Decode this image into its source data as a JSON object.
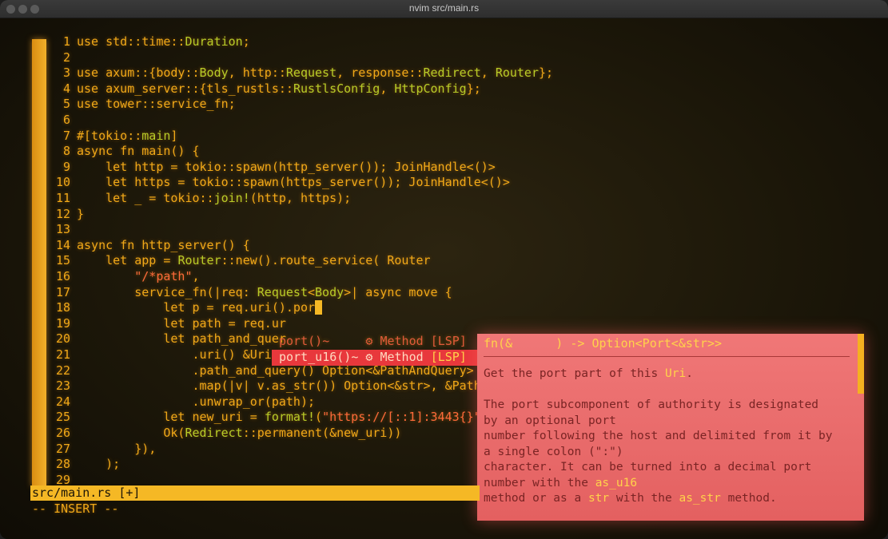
{
  "window": {
    "title": "nvim src/main.rs"
  },
  "code": [
    {
      "n": "1",
      "i": "",
      "parts": [
        {
          "t": "use std::time::",
          "c": ""
        },
        {
          "t": "Duration",
          "c": "g"
        },
        {
          "t": ";",
          "c": ""
        }
      ]
    },
    {
      "n": "2",
      "i": "",
      "parts": []
    },
    {
      "n": "3",
      "i": "",
      "parts": [
        {
          "t": "use axum::{body::",
          "c": ""
        },
        {
          "t": "Body",
          "c": "g"
        },
        {
          "t": ", http::",
          "c": ""
        },
        {
          "t": "Request",
          "c": "g"
        },
        {
          "t": ", response::",
          "c": ""
        },
        {
          "t": "Redirect",
          "c": "g"
        },
        {
          "t": ", ",
          "c": ""
        },
        {
          "t": "Router",
          "c": "g"
        },
        {
          "t": "};",
          "c": ""
        }
      ]
    },
    {
      "n": "4",
      "i": "",
      "parts": [
        {
          "t": "use axum_server::{tls_rustls::",
          "c": ""
        },
        {
          "t": "RustlsConfig",
          "c": "g"
        },
        {
          "t": ", ",
          "c": ""
        },
        {
          "t": "HttpConfig",
          "c": "g"
        },
        {
          "t": "};",
          "c": ""
        }
      ]
    },
    {
      "n": "5",
      "i": "",
      "parts": [
        {
          "t": "use tower::service_fn;",
          "c": ""
        }
      ]
    },
    {
      "n": "6",
      "i": "",
      "parts": []
    },
    {
      "n": "7",
      "i": "",
      "parts": [
        {
          "t": "#[tokio::",
          "c": ""
        },
        {
          "t": "main",
          "c": "g"
        },
        {
          "t": "]",
          "c": ""
        }
      ]
    },
    {
      "n": "8",
      "i": "",
      "parts": [
        {
          "t": "async fn main() {",
          "c": ""
        }
      ]
    },
    {
      "n": "9",
      "i": "    ",
      "parts": [
        {
          "t": "let http = tokio::spawn(http_server()); JoinHandle<()>",
          "c": ""
        }
      ]
    },
    {
      "n": "10",
      "i": "    ",
      "parts": [
        {
          "t": "let https = tokio::spawn(https_server()); JoinHandle<()>",
          "c": ""
        }
      ]
    },
    {
      "n": "11",
      "i": "    ",
      "parts": [
        {
          "t": "let _ = tokio::",
          "c": ""
        },
        {
          "t": "join!",
          "c": "g"
        },
        {
          "t": "(http, https);",
          "c": ""
        }
      ]
    },
    {
      "n": "12",
      "i": "",
      "parts": [
        {
          "t": "}",
          "c": ""
        }
      ]
    },
    {
      "n": "13",
      "i": "",
      "parts": []
    },
    {
      "n": "14",
      "i": "",
      "parts": [
        {
          "t": "async fn http_server() {",
          "c": ""
        }
      ]
    },
    {
      "n": "15",
      "i": "    ",
      "parts": [
        {
          "t": "let app = ",
          "c": ""
        },
        {
          "t": "Router",
          "c": "g"
        },
        {
          "t": "::new().route_service( Router",
          "c": ""
        }
      ]
    },
    {
      "n": "16",
      "i": "        ",
      "parts": [
        {
          "t": "\"/*path\"",
          "c": "s"
        },
        {
          "t": ",",
          "c": ""
        }
      ]
    },
    {
      "n": "17",
      "i": "        ",
      "parts": [
        {
          "t": "service_fn(|req: ",
          "c": ""
        },
        {
          "t": "Request",
          "c": "g"
        },
        {
          "t": "<",
          "c": ""
        },
        {
          "t": "Body",
          "c": "g"
        },
        {
          "t": ">| async move {",
          "c": ""
        }
      ]
    },
    {
      "n": "18",
      "i": "            ",
      "parts": [
        {
          "t": "let p = req.uri().por",
          "c": ""
        },
        {
          "t": " ",
          "c": "cursor"
        }
      ]
    },
    {
      "n": "19",
      "i": "            ",
      "parts": [
        {
          "t": "let path = req.ur",
          "c": ""
        }
      ]
    },
    {
      "n": "20",
      "i": "            ",
      "parts": [
        {
          "t": "let path_and_quer",
          "c": ""
        }
      ]
    },
    {
      "n": "21",
      "i": "                ",
      "parts": [
        {
          "t": ".uri() &Uri",
          "c": ""
        }
      ]
    },
    {
      "n": "22",
      "i": "                ",
      "parts": [
        {
          "t": ".path_and_query() Option<&PathAndQuery>",
          "c": ""
        }
      ]
    },
    {
      "n": "23",
      "i": "                ",
      "parts": [
        {
          "t": ".map(|v| v.as_str()) Option<&str>, &PathA",
          "c": ""
        }
      ]
    },
    {
      "n": "24",
      "i": "                ",
      "parts": [
        {
          "t": ".unwrap_or(path);",
          "c": ""
        }
      ]
    },
    {
      "n": "25",
      "i": "            ",
      "parts": [
        {
          "t": "let new_uri = ",
          "c": ""
        },
        {
          "t": "format!",
          "c": "g"
        },
        {
          "t": "(",
          "c": ""
        },
        {
          "t": "\"https://[::1]:3443{}\"",
          "c": "s"
        },
        {
          "t": ",",
          "c": ""
        }
      ]
    },
    {
      "n": "26",
      "i": "            ",
      "parts": [
        {
          "t": "Ok(",
          "c": ""
        },
        {
          "t": "Redirect",
          "c": "g"
        },
        {
          "t": "::permanent(&new_uri))",
          "c": ""
        }
      ]
    },
    {
      "n": "27",
      "i": "        ",
      "parts": [
        {
          "t": "}),",
          "c": ""
        }
      ]
    },
    {
      "n": "28",
      "i": "    ",
      "parts": [
        {
          "t": ");",
          "c": ""
        }
      ]
    },
    {
      "n": "29",
      "i": "",
      "parts": []
    }
  ],
  "completion": {
    "items": [
      {
        "name": "port()~",
        "kind": "⚙ Method",
        "source": "[LSP]",
        "selected": false
      },
      {
        "name": "port_u16()~",
        "kind": "⚙ Method",
        "source": "[LSP]",
        "selected": true
      }
    ]
  },
  "doc": {
    "signature": "fn(&      ) -> Option<Port<&str>>",
    "lines": [
      {
        "parts": [
          {
            "t": "Get the port part of this ",
            "c": ""
          },
          {
            "t": "Uri",
            "c": "hl"
          },
          {
            "t": ".",
            "c": ""
          }
        ]
      },
      {
        "parts": []
      },
      {
        "parts": [
          {
            "t": "The port subcomponent of authority is designated",
            "c": ""
          }
        ]
      },
      {
        "parts": [
          {
            "t": "by an optional port",
            "c": ""
          }
        ]
      },
      {
        "parts": [
          {
            "t": "number following the host and delimited from it by",
            "c": ""
          }
        ]
      },
      {
        "parts": [
          {
            "t": "a single colon (\":\")",
            "c": ""
          }
        ]
      },
      {
        "parts": [
          {
            "t": "character. It can be turned into a decimal port",
            "c": ""
          }
        ]
      },
      {
        "parts": [
          {
            "t": "number with the ",
            "c": ""
          },
          {
            "t": "as_u16",
            "c": "hl"
          }
        ]
      },
      {
        "parts": [
          {
            "t": "method or as a ",
            "c": ""
          },
          {
            "t": "str",
            "c": "hl"
          },
          {
            "t": " with the ",
            "c": ""
          },
          {
            "t": "as_str",
            "c": "hl"
          },
          {
            "t": " method.",
            "c": ""
          }
        ]
      }
    ]
  },
  "statusline": {
    "file": "src/main.rs [+]"
  },
  "mode": "-- INSERT --"
}
